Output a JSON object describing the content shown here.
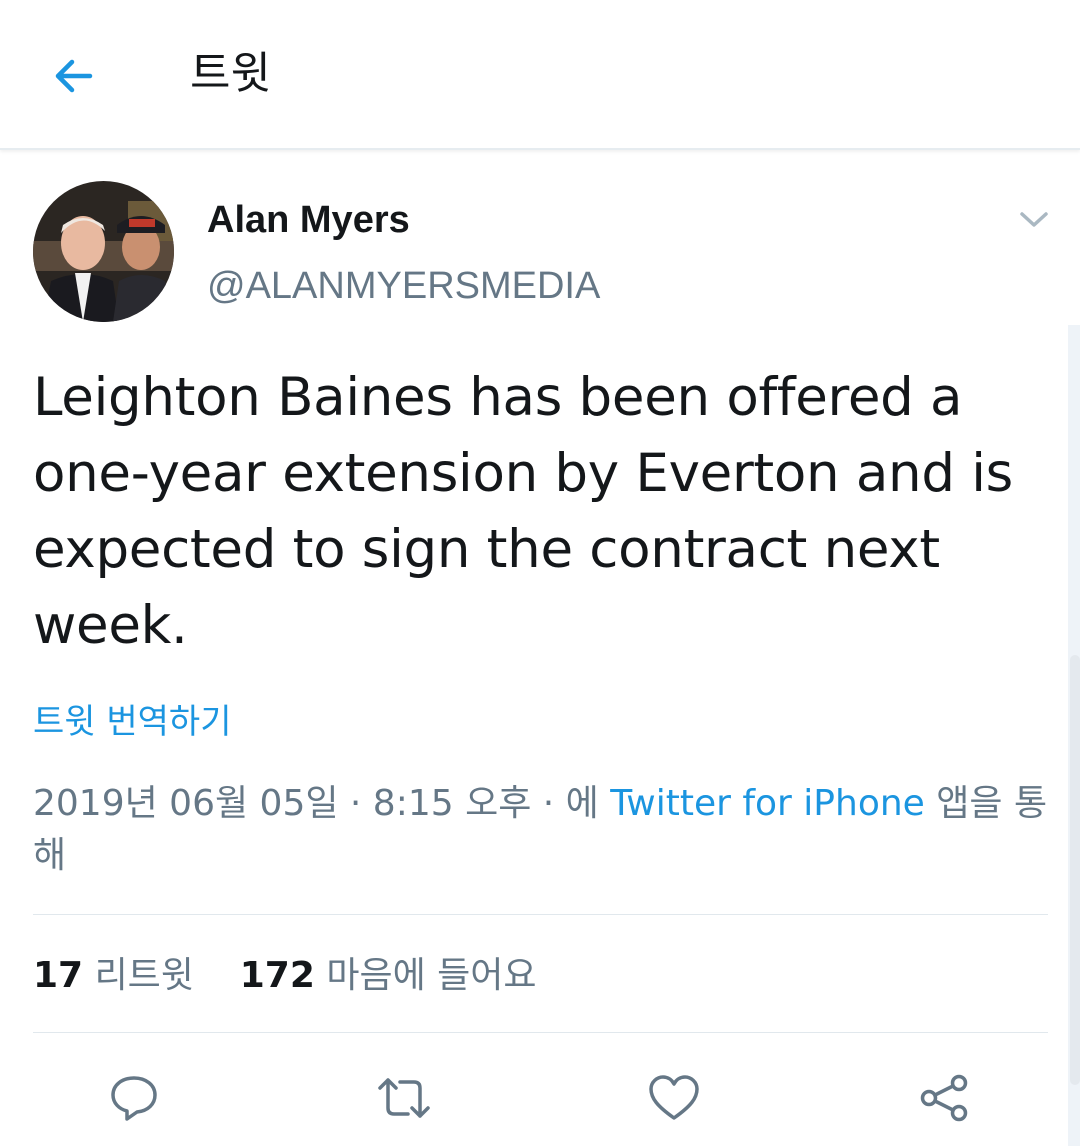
{
  "header": {
    "title": "트윗",
    "back_icon": "arrow-left-icon"
  },
  "tweet": {
    "display_name": "Alan Myers",
    "handle": "@ALANMYERSMEDIA",
    "text": "Leighton Baines has been offered a one-year extension by Everton and is expected to sign the contract next week.",
    "translate_label": "트윗 번역하기",
    "timestamp": "2019년 06월 05일 · 8:15 오후 · 에",
    "app_name": "Twitter for iPhone",
    "app_suffix": "앱을 통해",
    "retweet_count": "17",
    "retweet_label": "리트윗",
    "like_count": "172",
    "like_label": "마음에 들어요"
  },
  "actions": [
    {
      "name": "reply",
      "icon": "comment-icon"
    },
    {
      "name": "retweet",
      "icon": "retweet-icon"
    },
    {
      "name": "like",
      "icon": "heart-icon"
    },
    {
      "name": "share",
      "icon": "share-icon"
    }
  ],
  "colors": {
    "accent": "#1b95e0",
    "secondary_text": "#657786",
    "primary_text": "#14171a",
    "divider": "#e1e8ed"
  }
}
